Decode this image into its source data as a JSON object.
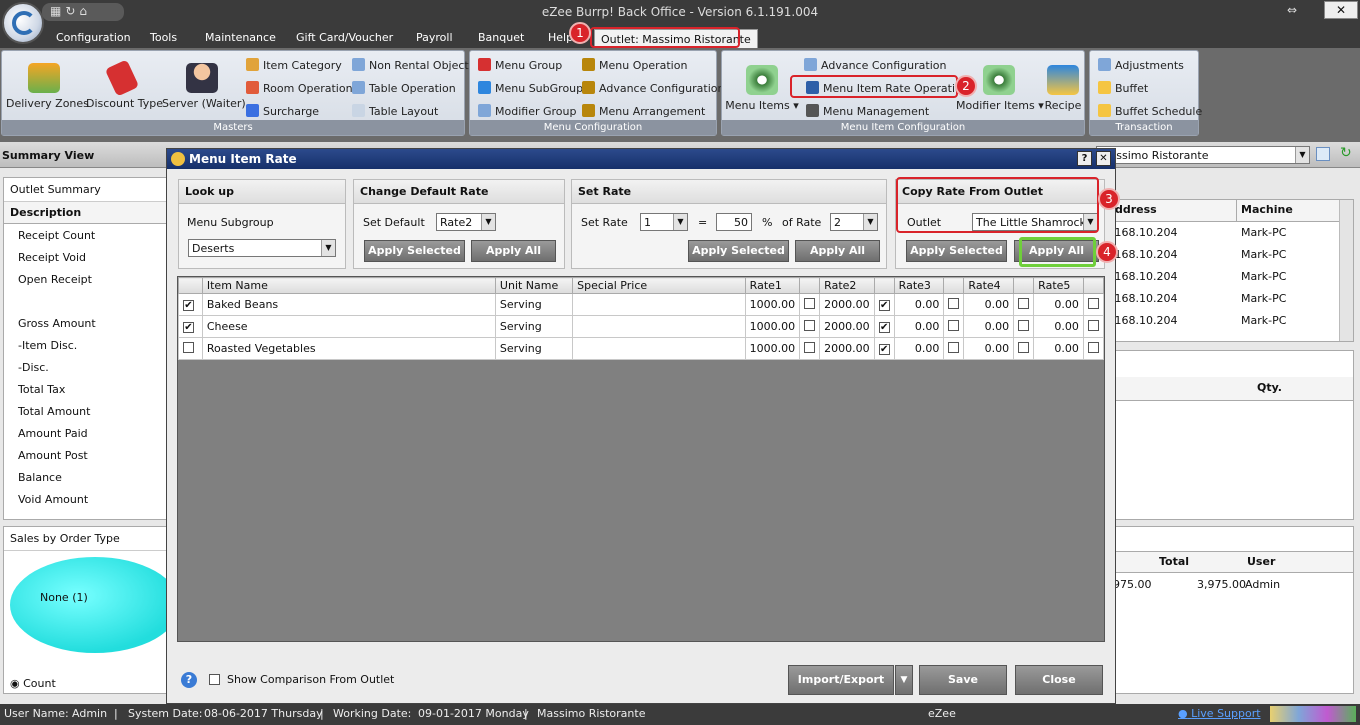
{
  "app": {
    "title": "eZee Burrp! Back Office - Version 6.1.191.004",
    "resize_glyph": "⇔",
    "close_glyph": "✕"
  },
  "menu": [
    "Configuration",
    "Tools",
    "Maintenance",
    "Gift Card/Voucher",
    "Payroll",
    "Banquet",
    "Help"
  ],
  "outlet_tab": "Outlet: Massimo Ristorante",
  "ribbon": {
    "masters": {
      "label": "Masters",
      "big": [
        "Delivery Zones",
        "Discount Type",
        "Server (Waiter)"
      ],
      "small": [
        "Item Category",
        "Room Operation",
        "Surcharge",
        "Non Rental Object",
        "Table Operation",
        "Table Layout"
      ]
    },
    "menu_config": {
      "label": "Menu Configuration",
      "items": [
        "Menu Group",
        "Menu SubGroup",
        "Modifier Group",
        "Menu Operation",
        "Advance Configuration",
        "Menu Arrangement"
      ]
    },
    "menu_item_config": {
      "label": "Menu Item Configuration",
      "big": [
        "Menu Items",
        "Modifier Items",
        "Recipe"
      ],
      "small": [
        "Advance Configuration",
        "Menu Item Rate Operation",
        "Menu Management"
      ]
    },
    "transaction": {
      "label": "Transaction",
      "items": [
        "Adjustments",
        "Buffet",
        "Buffet Schedule"
      ]
    }
  },
  "badges": [
    "1",
    "2",
    "3",
    "4"
  ],
  "summary": {
    "header": "Summary View",
    "outlet_summary": "Outlet Summary",
    "description": "Description",
    "rows": [
      "Receipt Count",
      "Receipt Void",
      "Open Receipt",
      "",
      "Gross Amount",
      "-Item Disc.",
      "-Disc.",
      "Total Tax",
      "Total Amount",
      "Amount Paid",
      "Amount Post",
      "Balance",
      "Void Amount"
    ],
    "sales": "Sales by Order Type",
    "pie_label": "None (1)",
    "count": "Count"
  },
  "right": {
    "outlet_select": "Massimo Ristorante",
    "cols": [
      "ddress",
      "Machine"
    ],
    "rows": [
      [
        ".168.10.204",
        "Mark-PC"
      ],
      [
        ".168.10.204",
        "Mark-PC"
      ],
      [
        ".168.10.204",
        "Mark-PC"
      ],
      [
        ".168.10.204",
        "Mark-PC"
      ],
      [
        ".168.10.204",
        "Mark-PC"
      ]
    ],
    "qty": "Qty.",
    "cols2": [
      "Total",
      "User"
    ],
    "row2": [
      "975.00",
      "3,975.00",
      "Admin"
    ]
  },
  "dialog": {
    "title": "Menu Item Rate",
    "help": "?",
    "close": "✕",
    "lookup": {
      "title": "Look up",
      "label": "Menu Subgroup",
      "value": "Deserts"
    },
    "default_rate": {
      "title": "Change Default Rate",
      "label": "Set Default",
      "value": "Rate2",
      "apply_selected": "Apply Selected",
      "apply_all": "Apply All"
    },
    "set_rate": {
      "title": "Set Rate",
      "label": "Set Rate",
      "rate_from": "1",
      "equals": "=",
      "percent": "50",
      "pct_sign": "%",
      "of_rate_label": "of Rate",
      "of_rate": "2",
      "apply_selected": "Apply Selected",
      "apply_all": "Apply All"
    },
    "copy": {
      "title": "Copy Rate From Outlet",
      "label": "Outlet",
      "value": "The Little Shamrock -",
      "apply_selected": "Apply Selected",
      "apply_all": "Apply All"
    },
    "columns": [
      "Item Name",
      "Unit Name",
      "Special Price",
      "Rate1",
      "Rate2",
      "Rate3",
      "Rate4",
      "Rate5"
    ],
    "rows": [
      {
        "checked": true,
        "name": "Baked Beans",
        "unit": "Serving",
        "special": "",
        "rates": [
          "1000.00",
          "2000.00",
          "0.00",
          "0.00",
          "0.00"
        ],
        "flags": [
          false,
          true,
          false,
          false,
          false
        ]
      },
      {
        "checked": true,
        "name": "Cheese",
        "unit": "Serving",
        "special": "",
        "rates": [
          "1000.00",
          "2000.00",
          "0.00",
          "0.00",
          "0.00"
        ],
        "flags": [
          false,
          true,
          false,
          false,
          false
        ]
      },
      {
        "checked": false,
        "name": "Roasted Vegetables",
        "unit": "Serving",
        "special": "",
        "rates": [
          "1000.00",
          "2000.00",
          "0.00",
          "0.00",
          "0.00"
        ],
        "flags": [
          false,
          true,
          false,
          false,
          false
        ]
      }
    ],
    "show_comparison": "Show Comparison From Outlet",
    "import_export": "Import/Export",
    "save": "Save",
    "close_btn": "Close"
  },
  "status": {
    "user_label": "User Name:",
    "user": "Admin",
    "sys_label": "System Date:",
    "sys": "08-06-2017 Thursday",
    "work_label": "Working Date:",
    "work": "09-01-2017 Monday",
    "outlet": "Massimo Ristorante",
    "center": "eZee",
    "live": "Live Support"
  }
}
